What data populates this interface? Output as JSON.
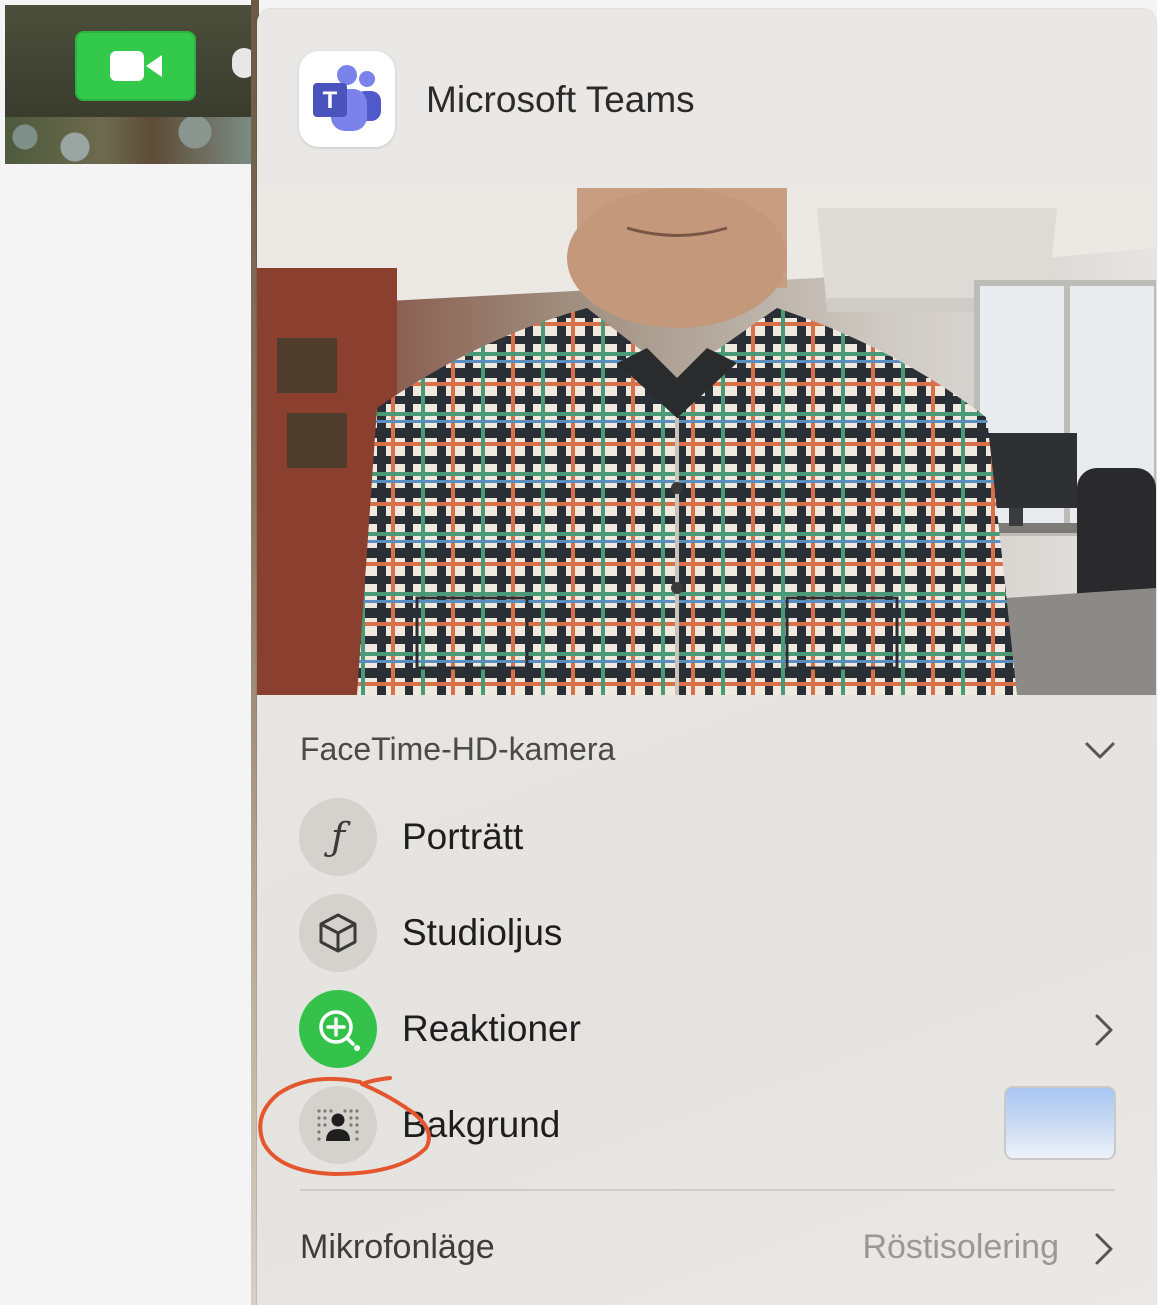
{
  "desktop": {
    "camera_indicator_icon": "video-camera-icon",
    "camera_indicator_color": "#33c94a"
  },
  "panel": {
    "app_name": "Microsoft Teams",
    "app_icon": "microsoft-teams-icon",
    "preview_content": "",
    "camera_source": {
      "label": "FaceTime-HD-kamera",
      "icon": "chevron-down-icon"
    },
    "effects": [
      {
        "label": "Porträtt",
        "icon": "portrait-f-icon",
        "trailing": ""
      },
      {
        "label": "Studioljus",
        "icon": "cube-icon",
        "trailing": ""
      },
      {
        "label": "Reaktioner",
        "icon": "reactions-icon",
        "trailing": "chevron-right-icon",
        "accent": "#34c24a"
      },
      {
        "label": "Bakgrund",
        "icon": "background-person-icon",
        "trailing": "background-thumbnail"
      }
    ],
    "microphone": {
      "label": "Mikrofonläge",
      "value": "Röstisolering",
      "icon": "chevron-right-icon"
    }
  },
  "annotation": {
    "type": "hand-drawn-circle",
    "color": "#e4572e",
    "target": "Bakgrund"
  }
}
